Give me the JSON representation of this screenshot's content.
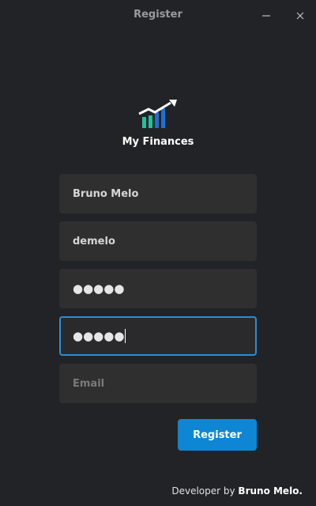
{
  "window": {
    "title": "Register"
  },
  "app": {
    "name": "My Finances",
    "logo_icon": "finance-chart-icon"
  },
  "form": {
    "name_value": "Bruno Melo",
    "username_value": "demelo",
    "password_mask": "●●●●●",
    "confirm_password_mask": "●●●●●",
    "email_placeholder": "Email",
    "submit_label": "Register"
  },
  "footer": {
    "prefix": "Developer by ",
    "author": "Bruno Melo."
  },
  "colors": {
    "accent": "#0f86d4",
    "background": "#222326",
    "field": "#2f2f30",
    "logo_green": "#1fc29a",
    "logo_blue": "#1f6fd0"
  }
}
